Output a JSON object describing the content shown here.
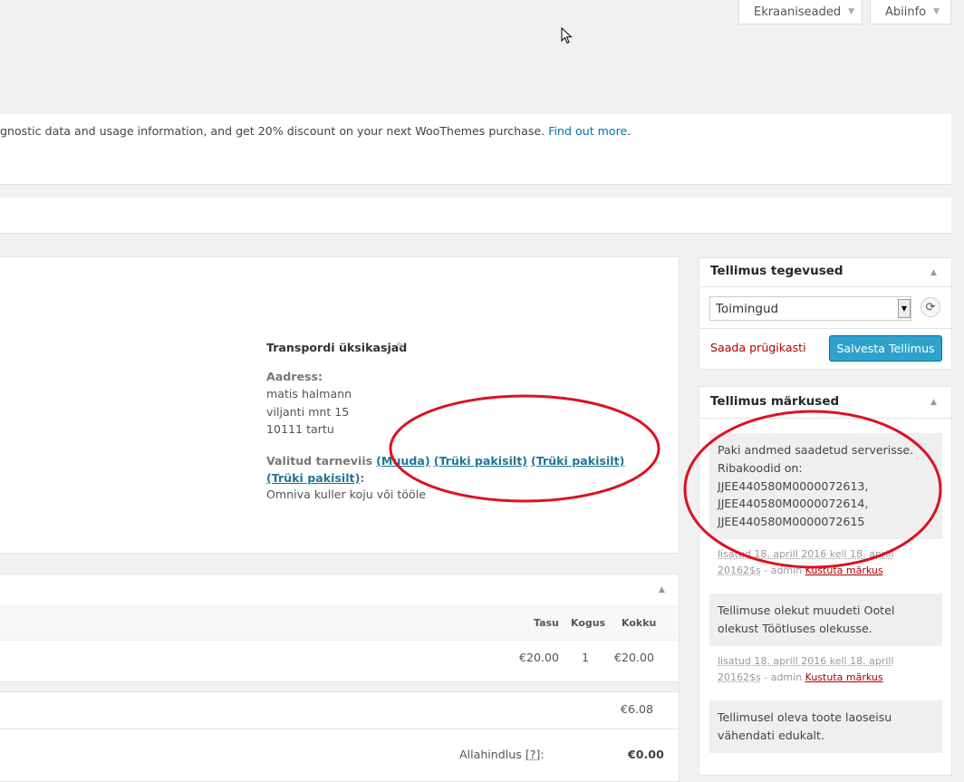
{
  "header": {
    "screen_options_label": "Ekraaniseaded",
    "help_label": "Abiinfo"
  },
  "notice": {
    "text": "gnostic data and usage information, and get 20% discount on your next WooThemes purchase. ",
    "link": "Find out more",
    "trail": "."
  },
  "shipping": {
    "title": "Transpordi üksikasjad",
    "address_label": "Aadress:",
    "address_lines": [
      "matis halmann",
      "viljanti mnt 15",
      "10111 tartu"
    ],
    "method_label": "Valitud tarneviis",
    "links": [
      "(Muuda)",
      "(Trüki pakisilt)",
      "(Trüki pakisilt)",
      "(Trüki pakisilt)"
    ],
    "carrier": "Omniva kuller koju või tööle"
  },
  "items": {
    "columns": [
      "Tasu",
      "Kogus",
      "Kokku"
    ],
    "row": {
      "cost": "€20.00",
      "qty": "1",
      "total": "€20.00"
    },
    "shipping_total": "€6.08",
    "discount_label": "Allahindlus",
    "discount_help": "[?]",
    "discount_colon": ":",
    "discount_value": "€0.00"
  },
  "order_actions": {
    "title": "Tellimus tegevused",
    "select_value": "Toimingud",
    "trash_label": "Saada prügikasti",
    "save_label": "Salvesta Tellimus"
  },
  "order_notes": {
    "title": "Tellimus märkused",
    "notes": [
      {
        "text": "Paki andmed saadetud serverisse. Ribakoodid on: JJEE440580M0000072613, JJEE440580M0000072614, JJEE440580M0000072615",
        "meta": "lisatud 18. aprill 2016 kell 18. aprill 20162$s",
        "by": " - admin ",
        "delete": "Kustuta märkus"
      },
      {
        "text": "Tellimuse olekut muudeti Ootel olekust Töötluses olekusse.",
        "meta": "lisatud 18. aprill 2016 kell 18. aprill 20162$s",
        "by": " - admin ",
        "delete": "Kustuta märkus"
      },
      {
        "text": "Tellimusel oleva toote laoseisu vähendati edukalt."
      }
    ]
  },
  "colors": {
    "accent": "#2ea2cc",
    "link": "#21759b",
    "danger": "#aa0000",
    "annotation": "#dd1122"
  },
  "icons": [
    "caret-down-icon",
    "pencil-icon",
    "caret-up-icon",
    "refresh-icon",
    "mouse-cursor-icon"
  ]
}
